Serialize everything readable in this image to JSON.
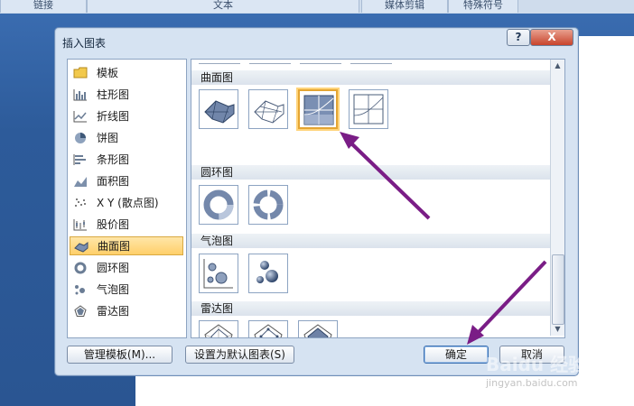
{
  "ribbon": {
    "groups": [
      "链接",
      "文本",
      "媒体剪辑",
      "特殊符号"
    ]
  },
  "dialog": {
    "title": "插入图表",
    "help_label": "?",
    "close_label": "X"
  },
  "categories": [
    {
      "label": "模板",
      "icon": "folder-icon"
    },
    {
      "label": "柱形图",
      "icon": "column-chart-icon"
    },
    {
      "label": "折线图",
      "icon": "line-chart-icon"
    },
    {
      "label": "饼图",
      "icon": "pie-chart-icon"
    },
    {
      "label": "条形图",
      "icon": "bar-chart-icon"
    },
    {
      "label": "面积图",
      "icon": "area-chart-icon"
    },
    {
      "label": "X Y (散点图)",
      "icon": "scatter-chart-icon"
    },
    {
      "label": "股价图",
      "icon": "stock-chart-icon"
    },
    {
      "label": "曲面图",
      "icon": "surface-chart-icon",
      "selected": true
    },
    {
      "label": "圆环图",
      "icon": "doughnut-chart-icon"
    },
    {
      "label": "气泡图",
      "icon": "bubble-chart-icon"
    },
    {
      "label": "雷达图",
      "icon": "radar-chart-icon"
    }
  ],
  "gallery": {
    "sections": [
      {
        "title": "曲面图",
        "items": [
          "3d-surface-icon",
          "wireframe-3d-surface-icon",
          "contour-icon",
          "wireframe-contour-icon"
        ],
        "selected_index": 2
      },
      {
        "title": "圆环图",
        "items": [
          "doughnut-icon",
          "exploded-doughnut-icon"
        ]
      },
      {
        "title": "气泡图",
        "items": [
          "bubble-icon",
          "3d-bubble-icon"
        ]
      },
      {
        "title": "雷达图",
        "items": [
          "radar-icon",
          "radar-markers-icon",
          "filled-radar-icon"
        ]
      }
    ]
  },
  "buttons": {
    "manage_templates": "管理模板(M)...",
    "set_default": "设置为默认图表(S)",
    "ok": "确定",
    "cancel": "取消"
  },
  "watermark": {
    "text": "Baidu 经验",
    "url": "jingyan.baidu.com"
  },
  "colors": {
    "accent": "#e4a533",
    "annotation_arrow": "#7a1d86"
  }
}
